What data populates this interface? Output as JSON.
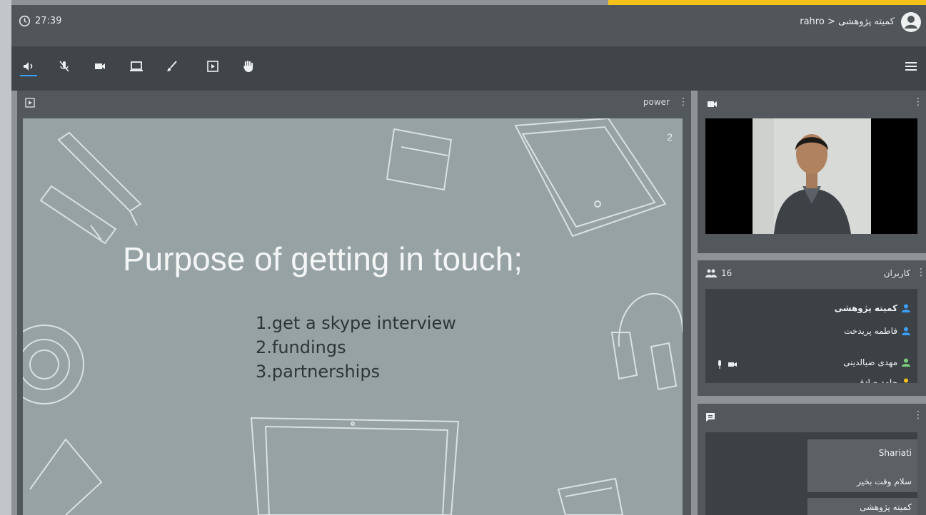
{
  "topbar": {
    "timer": "27:39",
    "meeting_title": "rahro > کمیته پژوهشی"
  },
  "toolbar": {
    "buttons": [
      {
        "icon": "speaker-icon",
        "active": true
      },
      {
        "icon": "mic-muted-icon"
      },
      {
        "icon": "camera-icon"
      },
      {
        "icon": "screen-share-icon"
      },
      {
        "icon": "brush-icon"
      },
      {
        "icon": "presentation-icon"
      },
      {
        "icon": "raise-hand-icon"
      }
    ],
    "menu_icon": "hamburger-menu-icon"
  },
  "presentation": {
    "name": "power",
    "slide_number": "2",
    "slide_title": "Purpose of getting in touch",
    "slide_title_punct": ";",
    "slide_items": [
      "1.get a skype interview",
      "2.fundings",
      "3.partnerships"
    ]
  },
  "users": {
    "count": "16",
    "title": "کاربران",
    "list": [
      {
        "name": "کمیته پژوهشی",
        "color": "#3aa0ff",
        "bold": true
      },
      {
        "name": "فاطمه پریدخت",
        "color": "#3aa0ff",
        "bold": false
      },
      {
        "name": "مهدی ضیالدینی",
        "color": "#7bd17b",
        "bold": false
      },
      {
        "name": "حامد صادقی",
        "color": "#f5c21a",
        "bold": false
      }
    ]
  },
  "chat": {
    "messages": [
      {
        "sender": "Shariati",
        "text": "سلام وقت بخیر"
      },
      {
        "sender": "کمیته پژوهشی",
        "text": ""
      }
    ]
  },
  "colors": {
    "accent": "#f5c21a",
    "active_underline": "#3aa0ff"
  }
}
